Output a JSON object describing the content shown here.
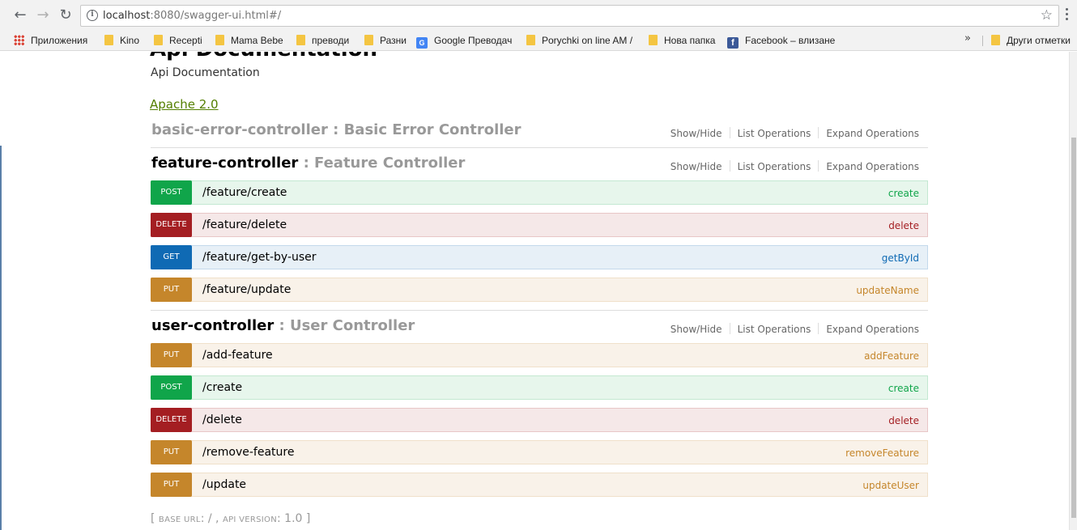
{
  "browser": {
    "url_host": "localhost",
    "url_path": ":8080/swagger-ui.html#/",
    "bookmarks": [
      {
        "label": "Приложения",
        "icon": "apps-icon"
      },
      {
        "label": "Kino",
        "icon": "folder-icon"
      },
      {
        "label": "Recepti",
        "icon": "folder-icon"
      },
      {
        "label": "Mama Bebe",
        "icon": "folder-icon"
      },
      {
        "label": "преводи",
        "icon": "folder-icon"
      },
      {
        "label": "Разни",
        "icon": "folder-icon"
      },
      {
        "label": "Google Преводач",
        "icon": "google-translate-icon"
      },
      {
        "label": "Porychki on line AM /",
        "icon": "folder-icon"
      },
      {
        "label": "Нова папка",
        "icon": "folder-icon"
      },
      {
        "label": "Facebook – влизане",
        "icon": "facebook-icon"
      }
    ],
    "more": "»",
    "other_bookmarks": "Други отметки"
  },
  "info": {
    "title": "Api Documentation",
    "description": "Api Documentation",
    "license": "Apache 2.0"
  },
  "links": {
    "show_hide": "Show/Hide",
    "list_ops": "List Operations",
    "expand_ops": "Expand Operations"
  },
  "resources": [
    {
      "name": "basic-error-controller",
      "description": " : Basic Error Controller",
      "operations": []
    },
    {
      "name": "feature-controller",
      "description": " : Feature Controller",
      "operations": [
        {
          "method": "POST",
          "path": "/feature/create",
          "nickname": "create"
        },
        {
          "method": "DELETE",
          "path": "/feature/delete",
          "nickname": "delete"
        },
        {
          "method": "GET",
          "path": "/feature/get-by-user",
          "nickname": "getById"
        },
        {
          "method": "PUT",
          "path": "/feature/update",
          "nickname": "updateName"
        }
      ]
    },
    {
      "name": "user-controller",
      "description": " : User Controller",
      "operations": [
        {
          "method": "PUT",
          "path": "/add-feature",
          "nickname": "addFeature"
        },
        {
          "method": "POST",
          "path": "/create",
          "nickname": "create"
        },
        {
          "method": "DELETE",
          "path": "/delete",
          "nickname": "delete"
        },
        {
          "method": "PUT",
          "path": "/remove-feature",
          "nickname": "removeFeature"
        },
        {
          "method": "PUT",
          "path": "/update",
          "nickname": "updateUser"
        }
      ]
    }
  ],
  "footer": {
    "open": "[ ",
    "base_label": "base url",
    "base_value": ": / , ",
    "version_label": "api version",
    "version_value": ": 1.0",
    "close": " ]"
  }
}
